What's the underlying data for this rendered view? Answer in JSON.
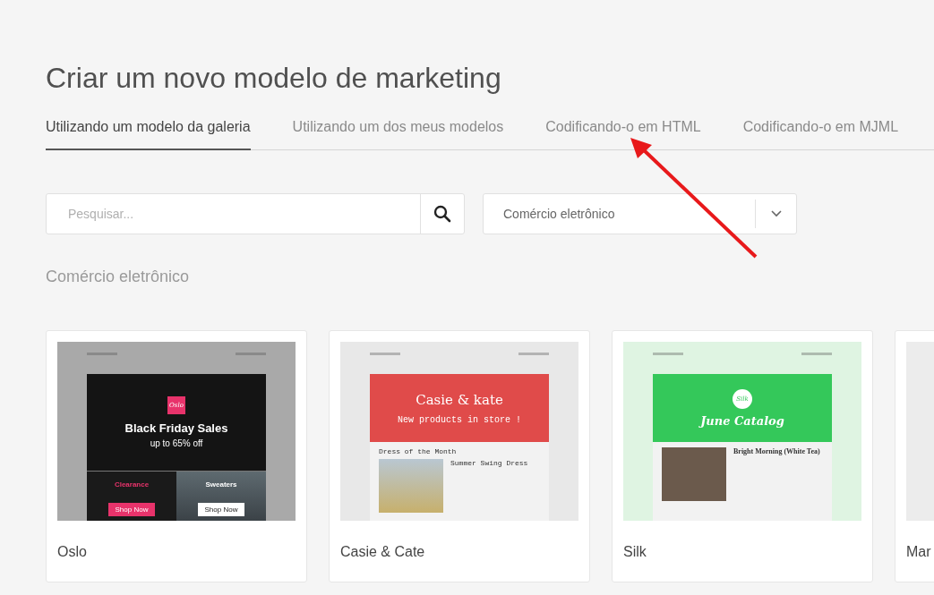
{
  "title": "Criar um novo modelo de marketing",
  "tabs": [
    {
      "label": "Utilizando um modelo da galeria",
      "selected": true
    },
    {
      "label": "Utilizando um dos meus modelos",
      "selected": false
    },
    {
      "label": "Codificando-o em HTML",
      "selected": false
    },
    {
      "label": "Codificando-o em MJML",
      "selected": false
    }
  ],
  "search": {
    "placeholder": "Pesquisar..."
  },
  "category_select": {
    "value": "Comércio eletrônico"
  },
  "section_heading": "Comércio eletrônico",
  "templates": [
    {
      "name": "Oslo",
      "kind": "oslo",
      "preview": {
        "logo": "Oslo",
        "headline": "Black Friday Sales",
        "subline": "up to 65% off",
        "left_title": "Clearance",
        "right_title": "Sweaters",
        "left_button": "Shop Now",
        "right_button": "Shop Now"
      }
    },
    {
      "name": "Casie & Cate",
      "kind": "casie",
      "preview": {
        "headline": "Casie & kate",
        "subline": "New products in store !",
        "section": "Dress of the Month",
        "product": "Summer Swing Dress"
      }
    },
    {
      "name": "Silk",
      "kind": "silk",
      "preview": {
        "logo": "Silk",
        "headline": "June Catalog",
        "product": "Bright Morning (White Tea)"
      }
    },
    {
      "name": "Mar",
      "kind": "blank"
    }
  ]
}
